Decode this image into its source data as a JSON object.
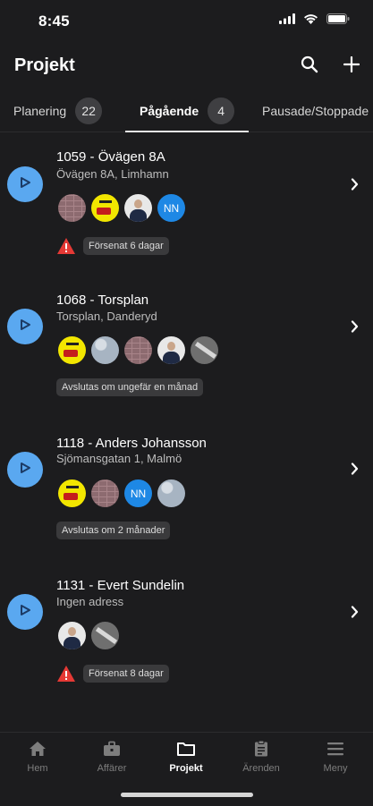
{
  "status_bar": {
    "time": "8:45"
  },
  "header": {
    "title": "Projekt"
  },
  "tabs": [
    {
      "label": "Planering",
      "count": "22"
    },
    {
      "label": "Pågående",
      "count": "4"
    },
    {
      "label": "Pausade/Stoppade"
    }
  ],
  "projects": [
    {
      "title": "1059 - Övägen 8A",
      "address": "Övägen 8A, Limhamn",
      "avatars": [
        "brick",
        "logo",
        "person",
        "NN"
      ],
      "status": "Försenat 6 dagar",
      "warning": true
    },
    {
      "title": "1068 - Torsplan",
      "address": "Torsplan, Danderyd",
      "avatars": [
        "logo",
        "gray",
        "brick",
        "person",
        "road"
      ],
      "status": "Avslutas om ungefär en månad",
      "warning": false
    },
    {
      "title": "1118 - Anders Johansson",
      "address": "Sjömansgatan 1, Malmö",
      "avatars": [
        "logo",
        "brick",
        "NN",
        "gray"
      ],
      "status": "Avslutas om 2 månader",
      "warning": false
    },
    {
      "title": "1131 - Evert Sundelin",
      "address": "Ingen adress",
      "avatars": [
        "person",
        "road"
      ],
      "status": "Försenat 8 dagar",
      "warning": true
    }
  ],
  "bottom_nav": [
    {
      "label": "Hem",
      "icon": "home-icon"
    },
    {
      "label": "Affärer",
      "icon": "briefcase-icon"
    },
    {
      "label": "Projekt",
      "icon": "folder-icon",
      "active": true
    },
    {
      "label": "Ärenden",
      "icon": "clipboard-icon"
    },
    {
      "label": "Meny",
      "icon": "menu-icon"
    }
  ],
  "colors": {
    "accent": "#5aa8f0",
    "warning": "#e53935",
    "background": "#1c1c1e"
  }
}
